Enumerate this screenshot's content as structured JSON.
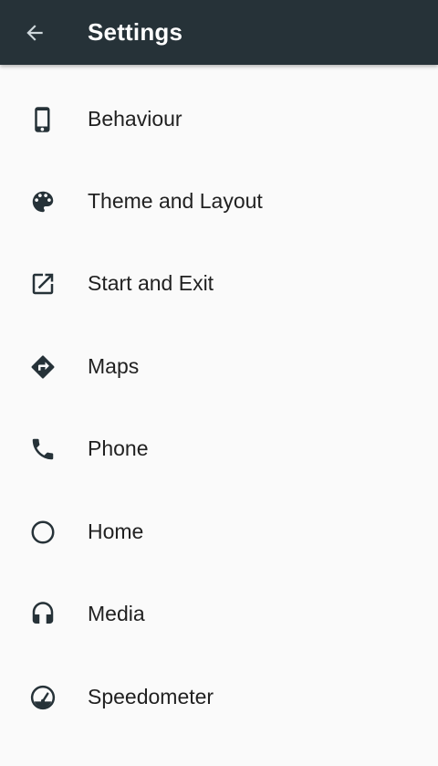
{
  "header": {
    "title": "Settings",
    "back_icon": "arrow-back-icon",
    "background": "#263238"
  },
  "settings": {
    "items": [
      {
        "label": "Behaviour",
        "icon": "phone-device-icon"
      },
      {
        "label": "Theme and Layout",
        "icon": "palette-icon"
      },
      {
        "label": "Start and Exit",
        "icon": "open-in-new-icon"
      },
      {
        "label": "Maps",
        "icon": "directions-icon"
      },
      {
        "label": "Phone",
        "icon": "phone-call-icon"
      },
      {
        "label": "Home",
        "icon": "circle-icon"
      },
      {
        "label": "Media",
        "icon": "headphones-icon"
      },
      {
        "label": "Speedometer",
        "icon": "speedometer-icon"
      }
    ]
  },
  "colors": {
    "icon": "#263238",
    "text": "#212121",
    "background": "#fafafa"
  }
}
